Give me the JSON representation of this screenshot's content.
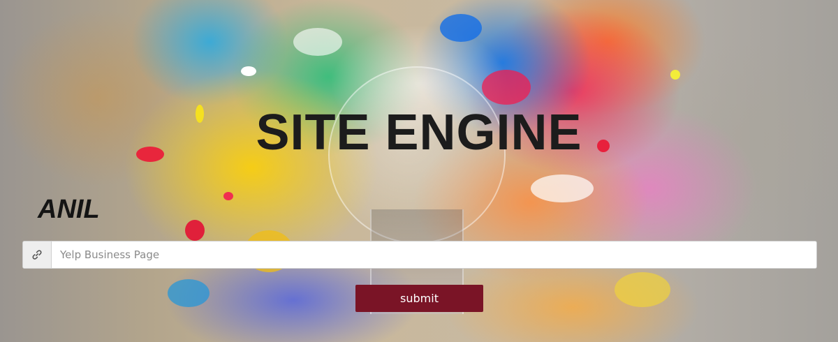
{
  "hero": {
    "title": "SITE ENGINE",
    "subtitle": "ANIL"
  },
  "form": {
    "input_icon": "link-icon",
    "input_placeholder": "Yelp Business Page",
    "input_value": "",
    "submit_label": "submit"
  },
  "colors": {
    "submit_bg": "#7a1426",
    "title_text": "#1c1c1c"
  }
}
